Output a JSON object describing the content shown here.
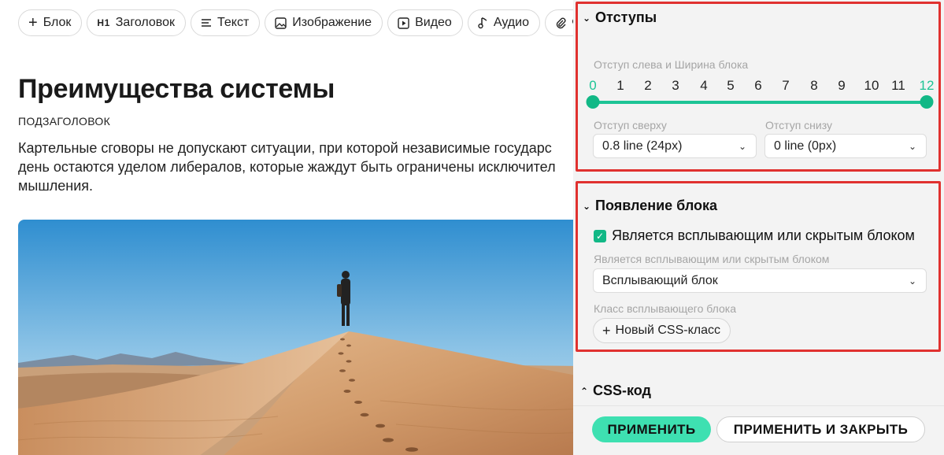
{
  "toolbar": {
    "items": [
      {
        "label": "Блок",
        "icon": "plus-icon",
        "glyph": "+"
      },
      {
        "label": "Заголовок",
        "icon": "heading-icon",
        "glyph": "H1"
      },
      {
        "label": "Текст",
        "icon": "text-lines-icon",
        "glyph": "☰"
      },
      {
        "label": "Изображение",
        "icon": "image-icon",
        "glyph": "▣"
      },
      {
        "label": "Видео",
        "icon": "video-icon",
        "glyph": "▷"
      },
      {
        "label": "Аудио",
        "icon": "music-note-icon",
        "glyph": "♪"
      },
      {
        "label": "Фа",
        "icon": "paperclip-icon",
        "glyph": "🖇"
      }
    ]
  },
  "content": {
    "headline": "Преимущества системы",
    "subtitle": "ПОДЗАГОЛОВОК",
    "body": "Картельные сговоры не допускают ситуации, при которой независимые государс\nдень остаются уделом либералов, которые жаждут быть ограничены исключител\nмышления."
  },
  "spacing": {
    "title": "Отступы",
    "width_label": "Отступ слева и Ширина блока",
    "scale": [
      "0",
      "1",
      "2",
      "3",
      "4",
      "5",
      "6",
      "7",
      "8",
      "9",
      "10",
      "11",
      "12"
    ],
    "range_start": 0,
    "range_end": 12,
    "top_label": "Отступ сверху",
    "top_value": "0.8 line (24px)",
    "bottom_label": "Отступ снизу",
    "bottom_value": "0 line (0px)"
  },
  "appearance": {
    "title": "Появление блока",
    "checkbox_label": "Является всплывающим или скрытым блоком",
    "checkbox_checked": true,
    "type_label": "Является всплывающим или скрытым блоком",
    "type_value": "Всплывающий блок",
    "class_label": "Класс всплывающего блока",
    "new_class_button": "Новый CSS-класс"
  },
  "css_section": {
    "title": "CSS-код"
  },
  "footer": {
    "apply": "ПРИМЕНИТЬ",
    "apply_close": "ПРИМЕНИТЬ И ЗАКРЫТЬ"
  },
  "colors": {
    "accent": "#1dc495",
    "apply_button": "#3ee0b1",
    "highlight_border": "#e0312f"
  }
}
